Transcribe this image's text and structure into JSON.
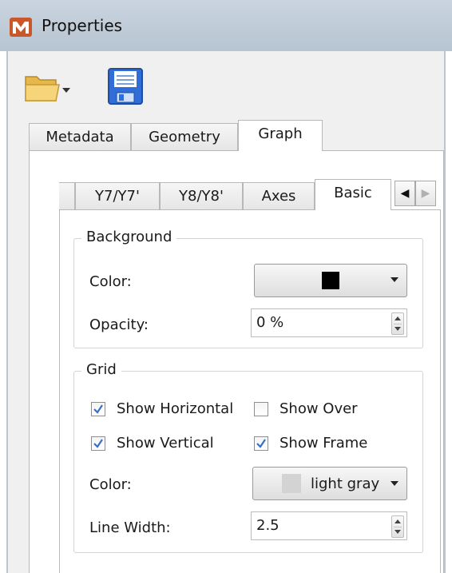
{
  "window": {
    "title": "Properties"
  },
  "toolbar": {
    "open_icon": "folder-icon",
    "save_icon": "floppy-disk-icon"
  },
  "outer_tabs": [
    {
      "label": "Metadata",
      "active": false
    },
    {
      "label": "Geometry",
      "active": false
    },
    {
      "label": "Graph",
      "active": true
    }
  ],
  "inner_tabs": [
    {
      "label": "Y7/Y7'",
      "active": false
    },
    {
      "label": "Y8/Y8'",
      "active": false
    },
    {
      "label": "Axes",
      "active": false
    },
    {
      "label": "Basic",
      "active": true
    }
  ],
  "background_group": {
    "title": "Background",
    "color_label": "Color:",
    "color_value": "#000000",
    "opacity_label": "Opacity:",
    "opacity_value": "0 %"
  },
  "grid_group": {
    "title": "Grid",
    "show_horizontal": {
      "label": "Show Horizontal",
      "checked": true
    },
    "show_over": {
      "label": "Show Over",
      "checked": false
    },
    "show_vertical": {
      "label": "Show Vertical",
      "checked": true
    },
    "show_frame": {
      "label": "Show Frame",
      "checked": true
    },
    "color_label": "Color:",
    "color_value": "light gray",
    "color_swatch": "#d3d3d3",
    "line_width_label": "Line Width:",
    "line_width_value": "2.5"
  },
  "colors": {
    "accent": "#3a6fc4",
    "folder": "#f2c75c",
    "save": "#2f6ed8"
  }
}
